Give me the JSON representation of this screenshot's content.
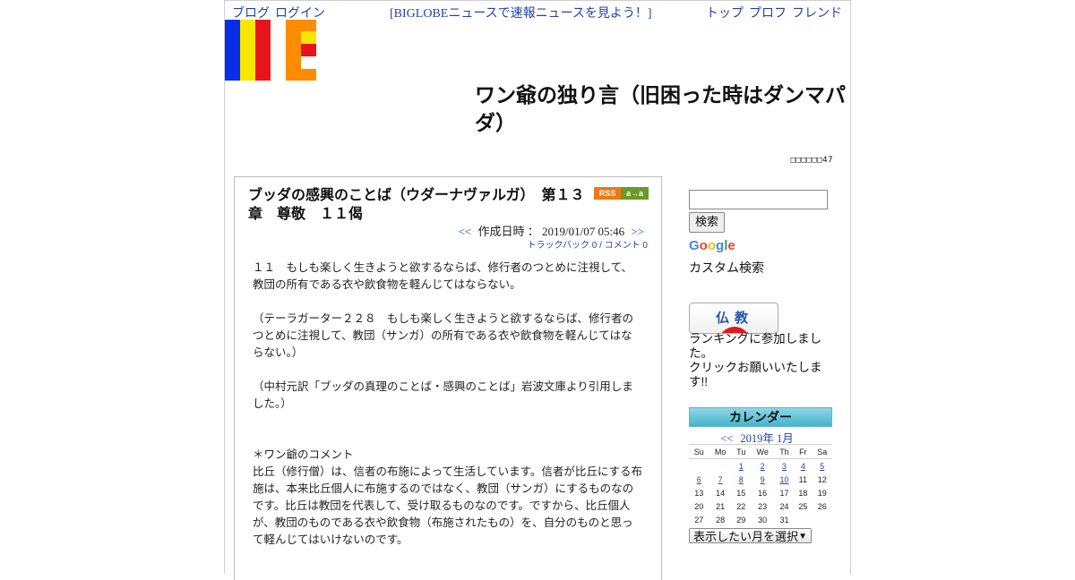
{
  "header": {
    "nav_left": [
      "ブログ",
      "ログイン"
    ],
    "nav_center": "[BIGLOBEニュースで速報ニュースを見よう！]",
    "nav_right": [
      "トップ",
      "プロフ",
      "フレンド"
    ],
    "blog_title": "ワン爺の独り言（旧困った時はダンマパダ）",
    "counter": "□□□□□□47",
    "logo_colors": [
      "#0a2ee8",
      "#f6e600",
      "#e8141c",
      "#ff8c00"
    ]
  },
  "entry": {
    "title": "ブッダの感興のことば（ウダーナヴァルガ）　第１３章　尊敬　１１偈",
    "rss_label": "RSS",
    "aa_label": "a→a",
    "prev_link": "<<",
    "date_label": "作成日時 ： 2019/01/07 05:46",
    "next_link": ">>",
    "trackback_comment": "トラックバック 0 / コメント 0",
    "body": {
      "p1": "１１　もしも楽しく生きようと欲するならば、修行者のつとめに注視して、教団の所有である衣や飲食物を軽んじてはならない。",
      "p2": "（テーラガーター２２８　もしも楽しく生きようと欲するならば、修行者のつとめに注視して、教団（サンガ）の所有である衣や飲食物を軽んじてはならない。）",
      "p3": "（中村元訳「ブッダの真理のことば・感興のことば」岩波文庫より引用しました。）",
      "p4_head": "＊ワン爺のコメント",
      "p4": "比丘（修行僧）は、信者の布施によって生活しています。信者が比丘にする布施は、本来比丘個人に布施するのではなく、教団（サンガ）にするものなのです。比丘は教団を代表して、受け取るものなのです。ですから、比丘個人が、教団のものである衣や飲食物（布施されたもの）を、自分のものと思って軽んじてはいけないのです。"
    }
  },
  "sidebar": {
    "search_placeholder": "",
    "search_button": "検索",
    "google_letters": [
      "G",
      "o",
      "o",
      "g",
      "l",
      "e"
    ],
    "google_colors": [
      "#4285f4",
      "#ea4335",
      "#fbbc05",
      "#4285f4",
      "#34a853",
      "#ea4335"
    ],
    "custom_search": "カスタム検索",
    "banner_text": "仏教",
    "ranking_line1": "ランキングに参加しました。",
    "ranking_line2": "クリックお願いいたします!!",
    "calendar_title": "カレンダー",
    "calendar_prev": "<<",
    "calendar_month": "2019年 1月",
    "weekdays": [
      "Su",
      "Mo",
      "Tu",
      "We",
      "Th",
      "Fr",
      "Sa"
    ],
    "weeks": [
      [
        "",
        "",
        "1",
        "2",
        "3",
        "4",
        "5"
      ],
      [
        "6",
        "7",
        "8",
        "9",
        "10",
        "11",
        "12"
      ],
      [
        "13",
        "14",
        "15",
        "16",
        "17",
        "18",
        "19"
      ],
      [
        "20",
        "21",
        "22",
        "23",
        "24",
        "25",
        "26"
      ],
      [
        "27",
        "28",
        "29",
        "30",
        "31",
        "",
        ""
      ]
    ],
    "linked_days": [
      "1",
      "2",
      "3",
      "4",
      "5",
      "6",
      "7",
      "8",
      "9",
      "10"
    ],
    "month_select": "表示したい月を選択"
  }
}
